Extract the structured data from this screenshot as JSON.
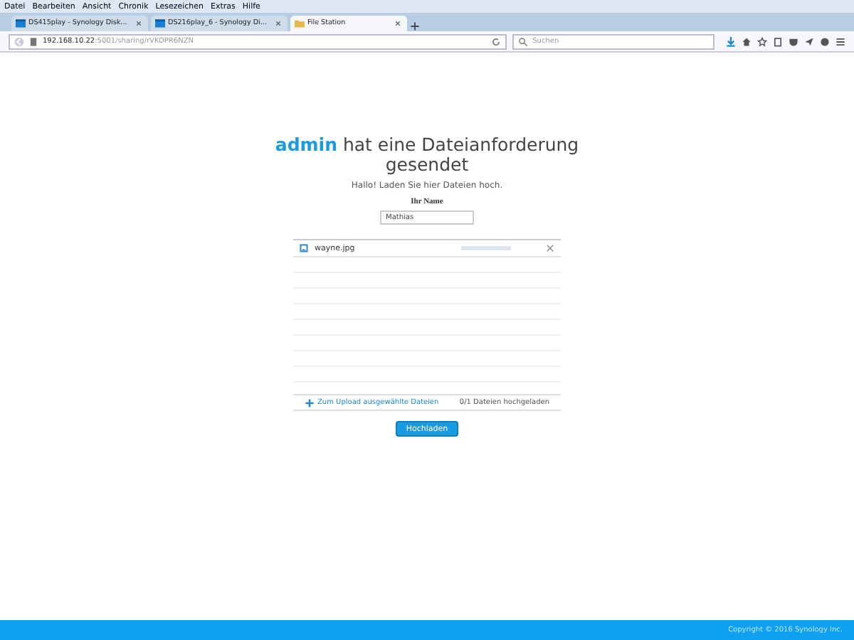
{
  "menu": [
    "Datei",
    "Bearbeiten",
    "Ansicht",
    "Chronik",
    "Lesezeichen",
    "Extras",
    "Hilfe"
  ],
  "tabs": [
    {
      "label": "DS415play - Synology Disk...",
      "selected": false,
      "kind": "app"
    },
    {
      "label": "DS216play_6 - Synology Di...",
      "selected": false,
      "kind": "app"
    },
    {
      "label": "File Station",
      "selected": true,
      "kind": "folder"
    }
  ],
  "address": {
    "host": "192.168.10.22",
    "path": ":5001/sharing/rVKOPR6NZN"
  },
  "search": {
    "placeholder": "Suchen"
  },
  "page": {
    "heading": "**admin** hat eine Dateianforderung gesendet",
    "subtitle": "Hallo! Laden Sie hier Dateien hoch.",
    "name_label": "Ihr Name",
    "name_value": "Mathias",
    "files": [
      {
        "name": "wayne.jpg"
      }
    ],
    "add_link": "Zum Upload ausgewählte Dateien",
    "count": "0/1 Dateien hochgeladen",
    "upload_button": "Hochladen"
  },
  "footer": "Copyright © 2016 Synology Inc."
}
